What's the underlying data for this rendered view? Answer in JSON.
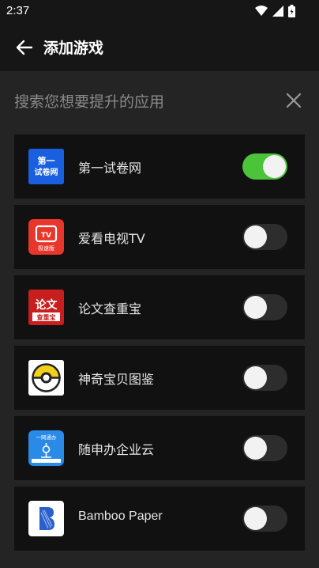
{
  "status": {
    "time": "2:37"
  },
  "header": {
    "title": "添加游戏"
  },
  "search": {
    "placeholder": "搜索您想要提升的应用"
  },
  "apps": [
    {
      "name": "第一试卷网",
      "icon": "diyi-shijuan-icon",
      "icon_text": "第一\n试卷网",
      "enabled": true
    },
    {
      "name": "爱看电视TV",
      "icon": "aikan-tv-icon",
      "icon_text": "TV\n极速版",
      "enabled": false
    },
    {
      "name": "论文查重宝",
      "icon": "lunwen-chachong-icon",
      "icon_text": "论文\n查重宝",
      "enabled": false
    },
    {
      "name": "神奇宝贝图鉴",
      "icon": "pokeball-icon",
      "icon_text": "",
      "enabled": false
    },
    {
      "name": "随申办企业云",
      "icon": "suishenban-icon",
      "icon_text": "一网通办",
      "enabled": false
    },
    {
      "name": "Bamboo Paper",
      "icon": "bamboo-paper-icon",
      "icon_text": "",
      "enabled": false
    }
  ],
  "colors": {
    "toggle_on": "#4cc43a",
    "background": "#242424",
    "card": "#111111"
  }
}
